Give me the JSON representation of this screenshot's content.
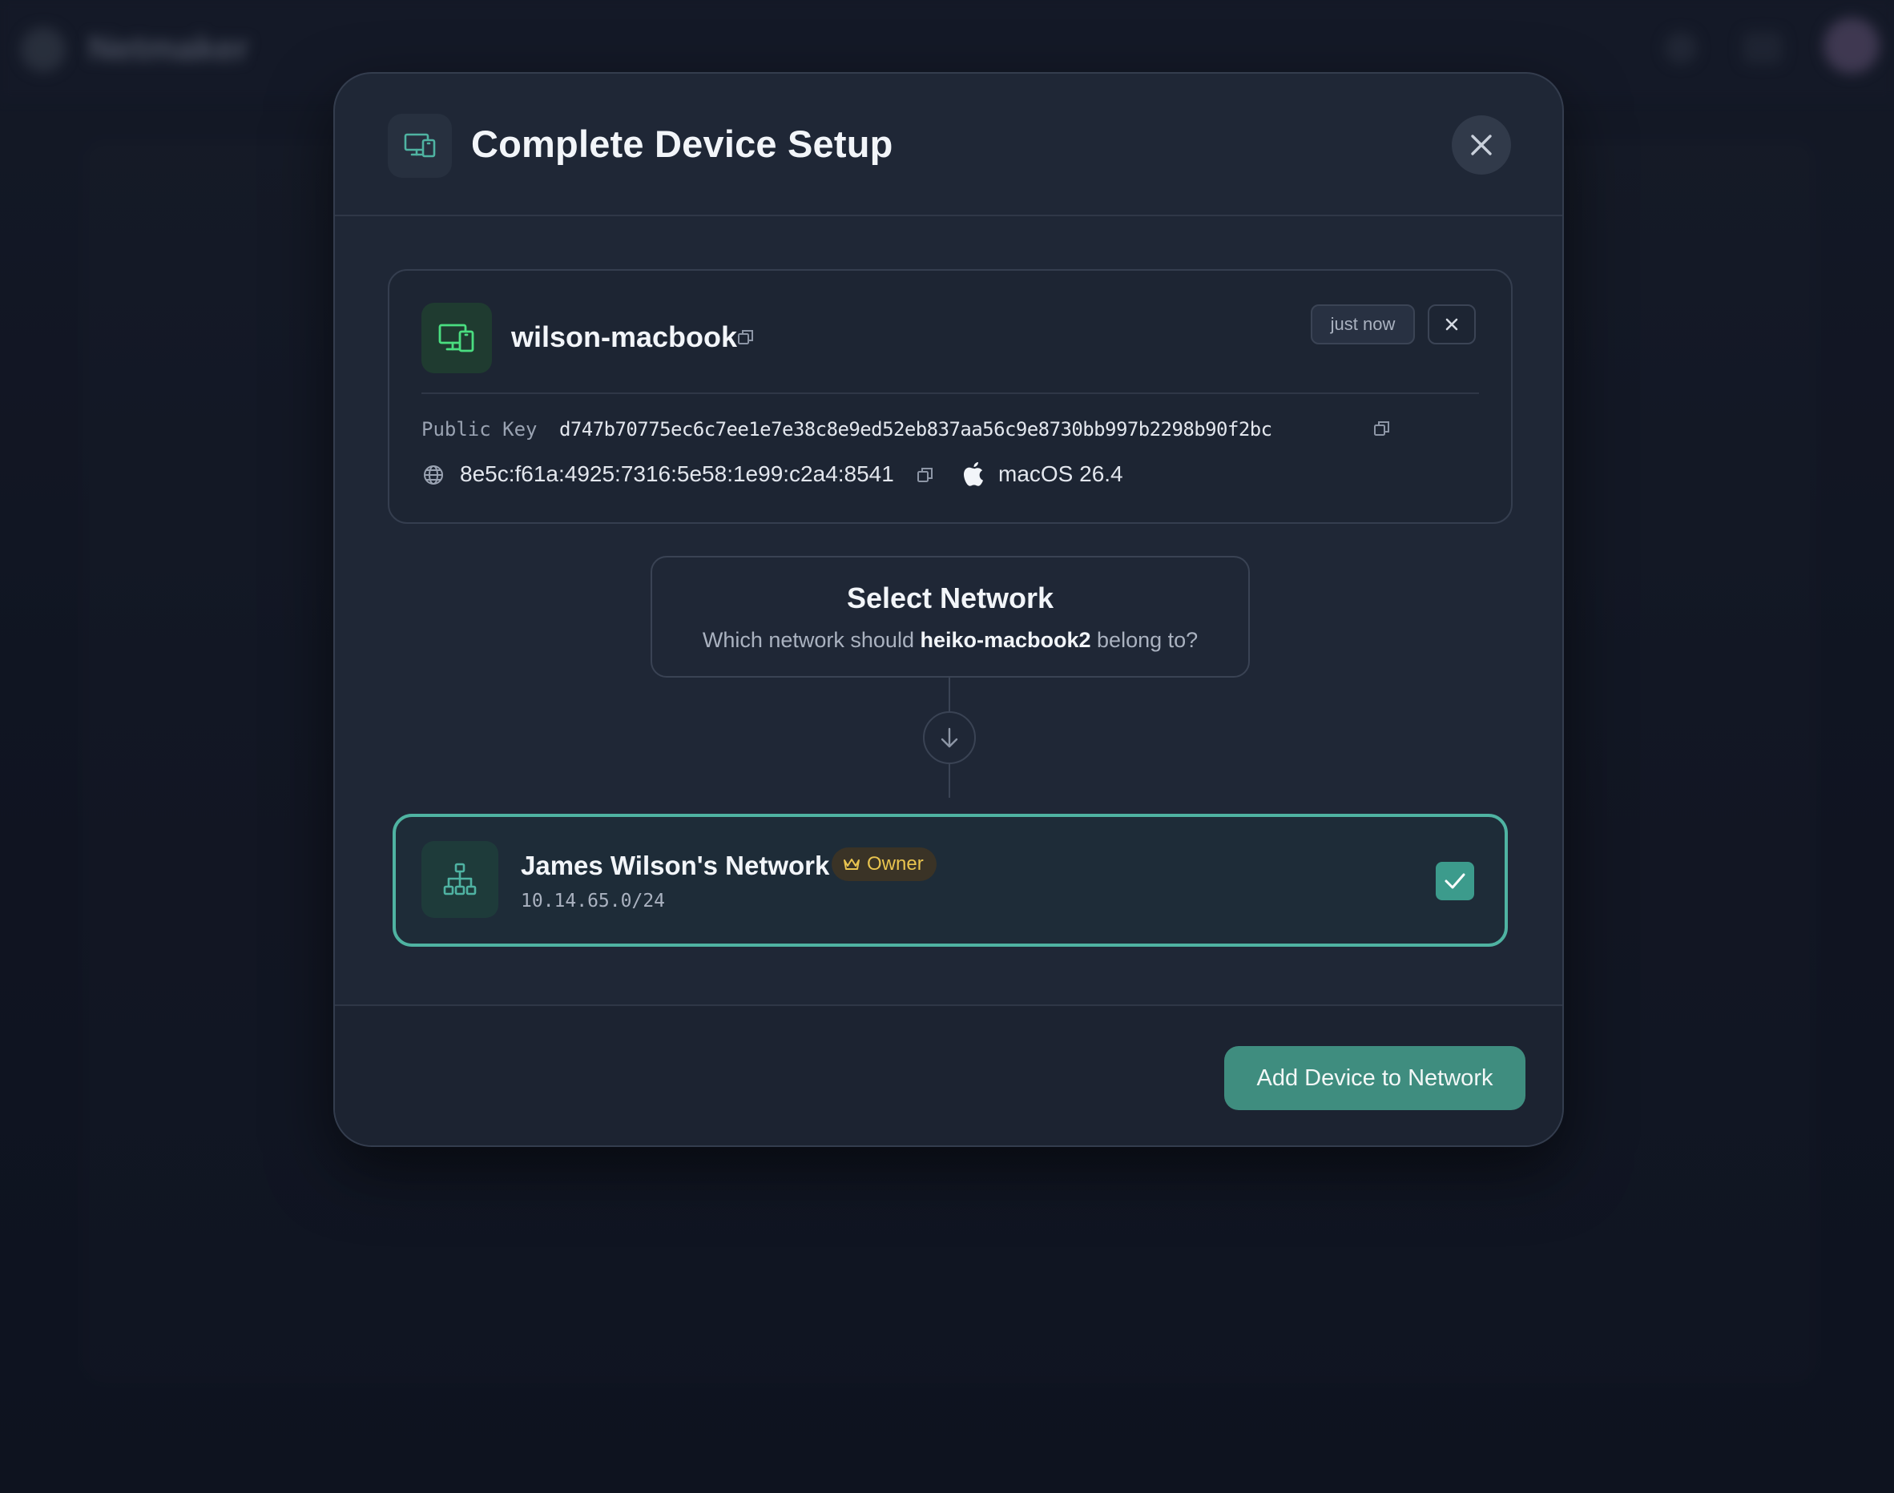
{
  "background": {
    "app_name": "Netmaker"
  },
  "modal": {
    "title": "Complete Device Setup",
    "icon": "devices-icon",
    "close_icon": "close-icon"
  },
  "device": {
    "name": "wilson-macbook",
    "time_badge": "just now",
    "public_key_label": "Public Key",
    "public_key": "d747b70775ec6c7ee1e7e38c8e9ed52eb837aa56c9e8730bb997b2298b90f2bc",
    "ip_address": "8e5c:f61a:4925:7316:5e58:1e99:c2a4:8541",
    "os": "macOS 26.4"
  },
  "select_network": {
    "title": "Select Network",
    "subtitle_prefix": "Which network should ",
    "subtitle_device": "heiko-macbook2",
    "subtitle_suffix": " belong to?"
  },
  "network_option": {
    "name": "James Wilson's Network",
    "role_badge": "Owner",
    "cidr": "10.14.65.0/24",
    "selected": true
  },
  "footer": {
    "primary_button": "Add Device to Network"
  },
  "colors": {
    "accent": "#4fb3a2",
    "primary_button": "#3f8d7f",
    "owner_badge": "#e9c44f",
    "device_icon": "#4ade80"
  }
}
